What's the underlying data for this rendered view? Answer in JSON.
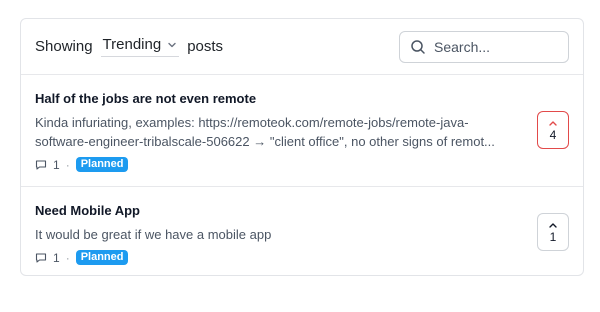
{
  "header": {
    "showing_label": "Showing",
    "sort_selected": "Trending",
    "posts_label": "posts",
    "search_placeholder": "Search..."
  },
  "posts": [
    {
      "title": "Half of the jobs are not even remote",
      "body": "Kinda infuriating, examples: https://remoteok.com/remote-jobs/remote-java-software-engineer-tribalscale-506622 → \"client office\", no other signs of remot...",
      "comments": "1",
      "status": "Planned",
      "votes": "4",
      "voted": true
    },
    {
      "title": "Need Mobile App",
      "body": "It would be great if we have a mobile app",
      "comments": "1",
      "status": "Planned",
      "votes": "1",
      "voted": false
    }
  ],
  "colors": {
    "status_badge": "#1d9bf0",
    "upvote_active": "#e24a4a"
  },
  "icons": {
    "search": "search-icon",
    "comment": "comment-icon",
    "upvote": "chevron-up-icon",
    "dropdown": "chevron-down-icon"
  }
}
